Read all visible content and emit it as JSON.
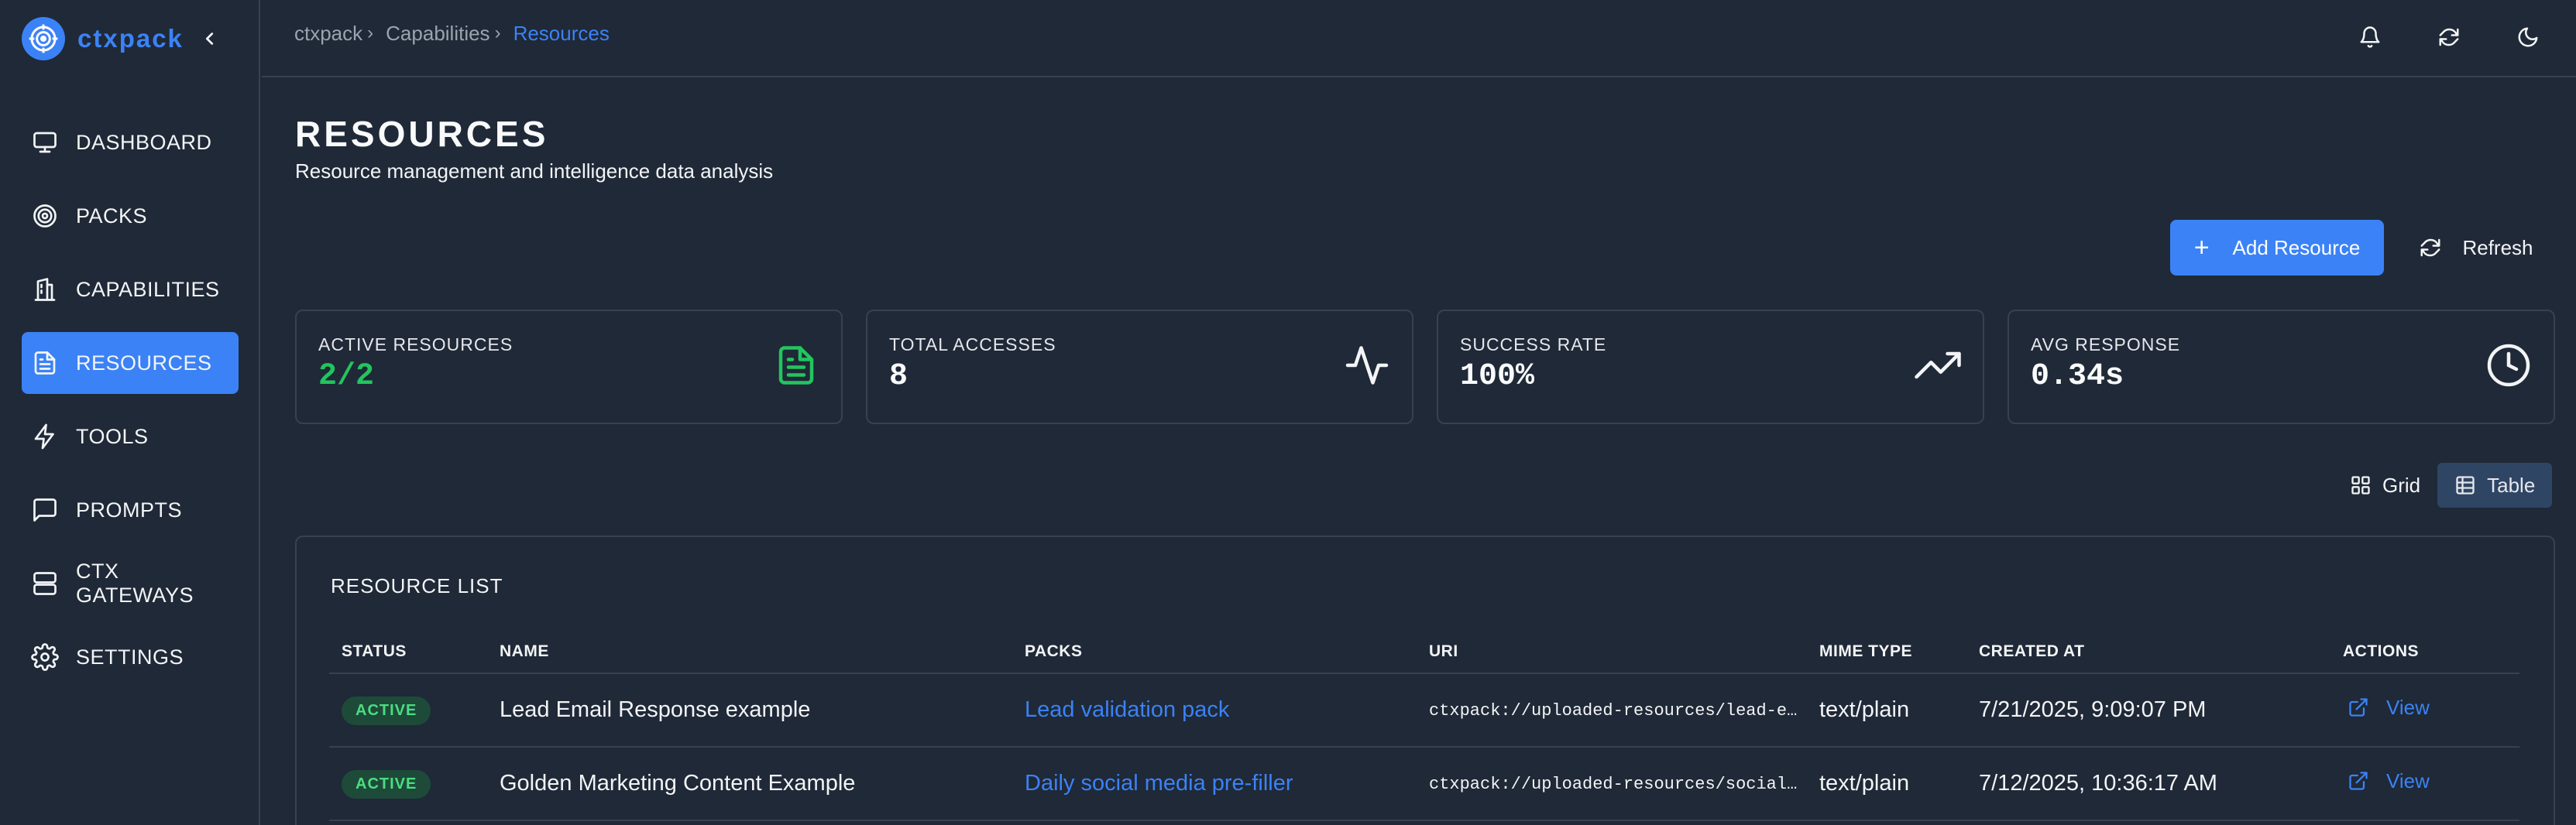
{
  "app": {
    "name": "ctxpack"
  },
  "colors": {
    "accent": "#3b82f6",
    "success": "#22c55e",
    "background": "#1f2937",
    "border": "#374151"
  },
  "sidebar": {
    "items": [
      {
        "label": "DASHBOARD",
        "icon": "monitor-icon",
        "active": false
      },
      {
        "label": "PACKS",
        "icon": "target-icon",
        "active": false
      },
      {
        "label": "CAPABILITIES",
        "icon": "building-icon",
        "active": false
      },
      {
        "label": "RESOURCES",
        "icon": "file-text-icon",
        "active": true
      },
      {
        "label": "TOOLS",
        "icon": "zap-icon",
        "active": false
      },
      {
        "label": "PROMPTS",
        "icon": "message-icon",
        "active": false
      },
      {
        "label": "CTX GATEWAYS",
        "icon": "server-icon",
        "active": false
      },
      {
        "label": "SETTINGS",
        "icon": "gear-icon",
        "active": false
      }
    ]
  },
  "breadcrumb": {
    "items": [
      "ctxpack",
      "Capabilities"
    ],
    "current": "Resources"
  },
  "page": {
    "title": "RESOURCES",
    "subtitle": "Resource management and intelligence data analysis"
  },
  "actions": {
    "add_label": "Add Resource",
    "refresh_label": "Refresh"
  },
  "stats": [
    {
      "label": "ACTIVE RESOURCES",
      "value": "2/2",
      "icon": "file-text-icon"
    },
    {
      "label": "TOTAL ACCESSES",
      "value": "8",
      "icon": "activity-icon"
    },
    {
      "label": "SUCCESS RATE",
      "value": "100%",
      "icon": "trending-up-icon"
    },
    {
      "label": "AVG RESPONSE",
      "value": "0.34s",
      "icon": "clock-icon"
    }
  ],
  "view_toggle": {
    "grid_label": "Grid",
    "table_label": "Table",
    "selected": "Table"
  },
  "resource_list": {
    "title": "RESOURCE LIST",
    "columns": [
      "STATUS",
      "NAME",
      "PACKS",
      "URI",
      "MIME TYPE",
      "CREATED AT",
      "ACTIONS"
    ],
    "rows": [
      {
        "status": "ACTIVE",
        "name": "Lead Email Response example",
        "pack": "Lead validation pack",
        "uri": "ctxpack://uploaded-resources/lead-e…",
        "mime": "text/plain",
        "created": "7/21/2025, 9:09:07 PM",
        "action": "View"
      },
      {
        "status": "ACTIVE",
        "name": "Golden Marketing Content Example",
        "pack": "Daily social media pre-filler",
        "uri": "ctxpack://uploaded-resources/social…",
        "mime": "text/plain",
        "created": "7/12/2025, 10:36:17 AM",
        "action": "View"
      }
    ]
  }
}
